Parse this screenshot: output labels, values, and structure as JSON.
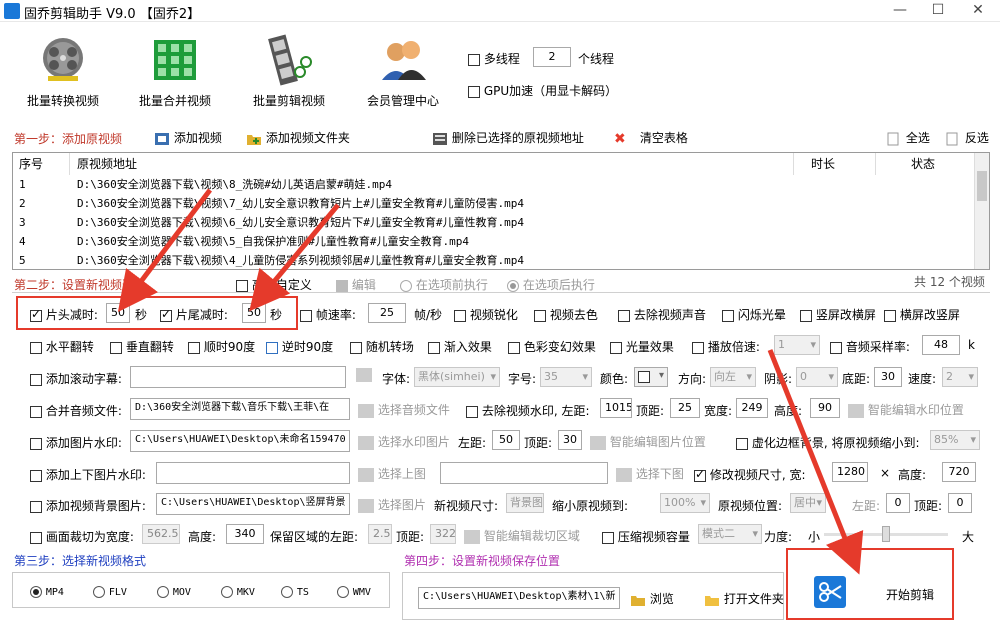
{
  "titlebar": {
    "title": "固乔剪辑助手 V9.0  【固乔2】"
  },
  "toolbar": {
    "batch_convert": "批量转换视频",
    "batch_merge": "批量合并视频",
    "batch_edit": "批量剪辑视频",
    "member_center": "会员管理中心",
    "multithread_label": "多线程",
    "thread_count": "2",
    "thread_unit": "个线程",
    "gpu_label": "GPU加速（用显卡解码）"
  },
  "step1": {
    "label": "第一步：添加原视频",
    "add_video": "添加视频",
    "add_folder": "添加视频文件夹",
    "delete_selected": "删除已选择的原视频地址",
    "clear_table": "清空表格",
    "select_all": "全选",
    "invert": "反选"
  },
  "table": {
    "headers": [
      "序号",
      "原视频地址",
      "时长",
      "状态"
    ],
    "rows": [
      {
        "no": "1",
        "path": "D:\\360安全浏览器下载\\视频\\8_洗碗#幼儿英语启蒙#萌娃.mp4"
      },
      {
        "no": "2",
        "path": "D:\\360安全浏览器下载\\视频\\7_幼儿安全意识教育短片上#儿童安全教育#儿童防侵害.mp4"
      },
      {
        "no": "3",
        "path": "D:\\360安全浏览器下载\\视频\\6_幼儿安全意识教育短片下#儿童安全教育#儿童性教育.mp4"
      },
      {
        "no": "4",
        "path": "D:\\360安全浏览器下载\\视频\\5_自我保护准则#儿童性教育#儿童安全教育.mp4"
      },
      {
        "no": "5",
        "path": "D:\\360安全浏览器下载\\视频\\4_儿童防侵害系列视频邻居#儿童性教育#儿童安全教育.mp4"
      }
    ]
  },
  "step2": {
    "label": "第二步：设置新视频选",
    "custom": "高级自定义",
    "edit": "编辑",
    "before": "在选项前执行",
    "after": "在选项后执行",
    "count": "共 12 个视频",
    "head_cut": "片头减时:",
    "head_val": "50",
    "sec": "秒",
    "tail_cut": "片尾减时:",
    "tail_val": "50",
    "frame_rate": "帧速率:",
    "frame_val": "25",
    "frame_unit": "帧/秒",
    "sharpen": "视频锐化",
    "decolor": "视频去色",
    "remove_audio": "去除视频声音",
    "flash": "闪烁光晕",
    "v2h": "竖屏改横屏",
    "h2v": "横屏改竖屏",
    "hflip": "水平翻转",
    "vflip": "垂直翻转",
    "cw90": "顺时90度",
    "ccw90": "逆时90度",
    "random_trans": "随机转场",
    "fade_in": "渐入效果",
    "color_change": "色彩变幻效果",
    "light": "光量效果",
    "speed": "播放倍速:",
    "speed_val": "1",
    "sample_rate": "音频采样率:",
    "sample_val": "48",
    "sample_unit": "k",
    "scroll_sub": "添加滚动字幕:",
    "font": "字体:",
    "font_val": "黑体(simhei)",
    "size": "字号:",
    "size_val": "35",
    "color": "颜色:",
    "direction": "方向:",
    "direction_val": "向左",
    "shadow": "阴影:",
    "shadow_val": "0",
    "bottom": "底距:",
    "bottom_val": "30",
    "speed2": "速度:",
    "speed2_val": "2",
    "merge_audio": "合并音频文件:",
    "audio_path": "D:\\360安全浏览器下载\\音乐下载\\王菲\\在",
    "select_audio": "选择音频文件",
    "remove_wm": "去除视频水印, 左距:",
    "wm_left": "1015",
    "top": "顶距:",
    "wm_top": "25",
    "width": "宽度:",
    "wm_width": "249",
    "height": "高度:",
    "wm_height": "90",
    "smart_wm": "智能编辑水印位置",
    "img_wm": "添加图片水印:",
    "img_wm_path": "C:\\Users\\HUAWEI\\Desktop\\未命名159470",
    "select_wm_img": "选择水印图片",
    "left": "左距:",
    "img_left": "50",
    "img_top": "30",
    "smart_img": "智能编辑图片位置",
    "blur_border": "虚化边框背景, 将原视频缩小到:",
    "blur_val": "85%",
    "tb_img": "添加上下图片水印:",
    "select_top": "选择上图",
    "select_bottom": "选择下图",
    "resize": "修改视频尺寸, 宽:",
    "resize_w": "1280",
    "x": "×",
    "height2": "高度:",
    "resize_h": "720",
    "bg_img": "添加视频背景图片:",
    "bg_path": "C:\\Users\\HUAWEI\\Desktop\\竖屏背景",
    "select_img": "选择图片",
    "new_size": "新视频尺寸:",
    "new_size_val": "背景图",
    "shrink": "缩小原视频到:",
    "shrink_val": "100%",
    "orig_pos": "原视频位置:",
    "orig_pos_val": "居中",
    "bg_left_val": "0",
    "bg_top_val": "0",
    "crop": "画面裁切为宽度:",
    "crop_w": "562.5",
    "crop_h": "340",
    "keep_left": "保留区域的左距:",
    "keep_left_val": "2.5",
    "keep_top_val": "322",
    "smart_crop": "智能编辑裁切区域",
    "compress": "压缩视频容量",
    "compress_mode": "模式二",
    "strength": "力度:",
    "small": "小",
    "big": "大",
    "strength_level": 0.5
  },
  "step3": {
    "label": "第三步：选择新视频格式",
    "formats": [
      "MP4",
      "FLV",
      "MOV",
      "MKV",
      "TS",
      "WMV"
    ]
  },
  "step4": {
    "label": "第四步：设置新视频保存位置",
    "path": "C:\\Users\\HUAWEI\\Desktop\\素材\\1\\新",
    "browse": "浏览",
    "open_folder": "打开文件夹"
  },
  "start": {
    "label": "开始剪辑"
  },
  "colors": {
    "accent": "#e53a2b",
    "step1": "#c0392b",
    "step3": "#2040c0",
    "step4": "#b030b0",
    "start_icon": "#1a78d8"
  }
}
